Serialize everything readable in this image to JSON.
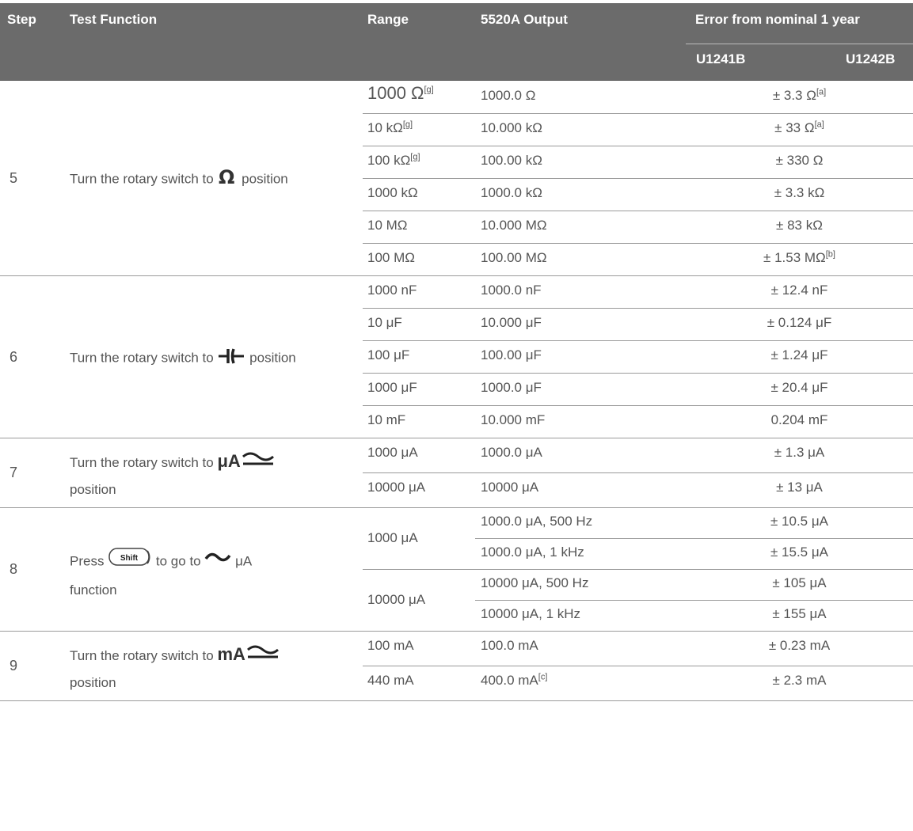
{
  "header": {
    "step": "Step",
    "test_function": "Test Function",
    "range": "Range",
    "output": "5520A Output",
    "error_group": "Error from nominal 1 year",
    "u1241b": "U1241B",
    "u1242b": "U1242B"
  },
  "rows": [
    {
      "step": "5",
      "fn_pre": "Turn the rotary switch to",
      "fn_post": "position",
      "icon": "ohm-icon",
      "items": [
        {
          "range": "1000 Ω",
          "range_sup": "[g]",
          "output": "1000.0 Ω",
          "error": "± 3.3 Ω",
          "error_sup": "[a]"
        },
        {
          "range": "10 kΩ",
          "range_sup": "[g]",
          "output": "10.000 kΩ",
          "error": "± 33 Ω",
          "error_sup": "[a]"
        },
        {
          "range": "100 kΩ",
          "range_sup": "[g]",
          "output": "100.00 kΩ",
          "error": "± 330 Ω",
          "error_sup": ""
        },
        {
          "range": "1000 kΩ",
          "range_sup": "",
          "output": "1000.0 kΩ",
          "error": "± 3.3 kΩ",
          "error_sup": ""
        },
        {
          "range": "10 MΩ",
          "range_sup": "",
          "output": "10.000 MΩ",
          "error": "± 83 kΩ",
          "error_sup": ""
        },
        {
          "range": "100 MΩ",
          "range_sup": "",
          "output": "100.00 MΩ",
          "error": "± 1.53 MΩ",
          "error_sup": "[b]"
        }
      ]
    },
    {
      "step": "6",
      "fn_pre": "Turn the rotary switch to",
      "fn_post": "position",
      "icon": "capacitor-icon",
      "items": [
        {
          "range": "1000 nF",
          "output": "1000.0 nF",
          "error": "± 12.4 nF"
        },
        {
          "range": "10 μF",
          "output": "10.000 μF",
          "error": "± 0.124 μF"
        },
        {
          "range": "100 μF",
          "output": "100.00 μF",
          "error": "± 1.24 μF"
        },
        {
          "range": "1000 μF",
          "output": "1000.0 μF",
          "error": "± 20.4 μF"
        },
        {
          "range": "10 mF",
          "output": "10.000 mF",
          "error": "0.204 mF"
        }
      ]
    },
    {
      "step": "7",
      "fn_pre": "Turn the rotary switch to",
      "fn_symbol": "μA",
      "fn_post": "position",
      "icon": "ac-dc-icon",
      "items": [
        {
          "range": "1000 μA",
          "output": "1000.0 μA",
          "error": "± 1.3 μA"
        },
        {
          "range": "10000 μA",
          "output": "10000 μA",
          "error": "± 13 μA"
        }
      ]
    },
    {
      "step": "8",
      "fn_pre": "Press",
      "fn_key": "Shift",
      "fn_mid": "to go to",
      "fn_unit": "μA",
      "fn_post": "function",
      "icon": "ac-icon",
      "groups": [
        {
          "range": "1000 μA",
          "items": [
            {
              "output": "1000.0 μA, 500 Hz",
              "error": "± 10.5 μA"
            },
            {
              "output": "1000.0 μA, 1 kHz",
              "error": "± 15.5 μA"
            }
          ]
        },
        {
          "range": "10000 μA",
          "items": [
            {
              "output": "10000 μA, 500 Hz",
              "error": "± 105 μA"
            },
            {
              "output": "10000 μA, 1 kHz",
              "error": "± 155 μA"
            }
          ]
        }
      ]
    },
    {
      "step": "9",
      "fn_pre": "Turn the rotary switch to",
      "fn_symbol": "mA",
      "fn_post": "position",
      "icon": "ac-dc-icon",
      "items": [
        {
          "range": "100 mA",
          "output": "100.0 mA",
          "error": "± 0.23 mA"
        },
        {
          "range": "440 mA",
          "output": "400.0 mA",
          "output_sup": "[c]",
          "error": "± 2.3 mA"
        }
      ]
    }
  ]
}
